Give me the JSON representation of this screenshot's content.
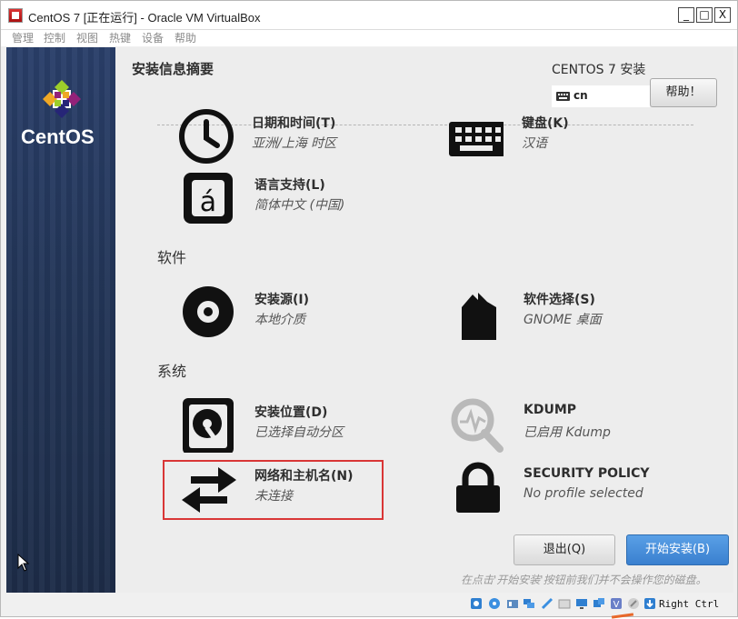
{
  "window": {
    "title": "CentOS 7 [正在运行] - Oracle VM VirtualBox",
    "buttons": {
      "minimize": "_",
      "maximize": "□",
      "close": "X"
    }
  },
  "menu": [
    "管理",
    "控制",
    "视图",
    "热键",
    "设备",
    "帮助"
  ],
  "installer": {
    "brand": "CentOS",
    "hub_title": "安装信息摘要",
    "product": "CENTOS 7 安装",
    "keyboard_layout": "cn",
    "help_label": "帮助！",
    "localization": {
      "datetime": {
        "name": "日期和时间(T)",
        "status": "亚洲/上海 时区"
      },
      "keyboard": {
        "name": "键盘(K)",
        "status": "汉语"
      },
      "language": {
        "name": "语言支持(L)",
        "status": "简体中文 (中国)"
      }
    },
    "software_section": "软件",
    "software": {
      "source": {
        "name": "安装源(I)",
        "status": "本地介质"
      },
      "selection": {
        "name": "软件选择(S)",
        "status": "GNOME 桌面"
      }
    },
    "system_section": "系统",
    "system": {
      "destination": {
        "name": "安装位置(D)",
        "status": "已选择自动分区"
      },
      "kdump": {
        "name": "KDUMP",
        "status": "已启用 Kdump"
      },
      "network": {
        "name": "网络和主机名(N)",
        "status": "未连接"
      },
      "security": {
        "name": "SECURITY POLICY",
        "status": "No profile selected"
      }
    },
    "quit_label": "退出(Q)",
    "begin_label": "开始安装(B)",
    "footer_note": "在点击'开始安装'按钮前我们并不会操作您的磁盘。"
  },
  "statusbar": {
    "host_key": "Right Ctrl",
    "icons": [
      "hdd-icon",
      "optical-icon",
      "audio-icon",
      "network-icon",
      "usb-icon",
      "shared-folder-icon",
      "display-icon",
      "recording-icon",
      "vbox-icon",
      "mouse-icon",
      "arrow-icon"
    ]
  },
  "colors": {
    "sidebar": "#233658",
    "accent": "#3a80cf",
    "highlight": "#d93636"
  }
}
